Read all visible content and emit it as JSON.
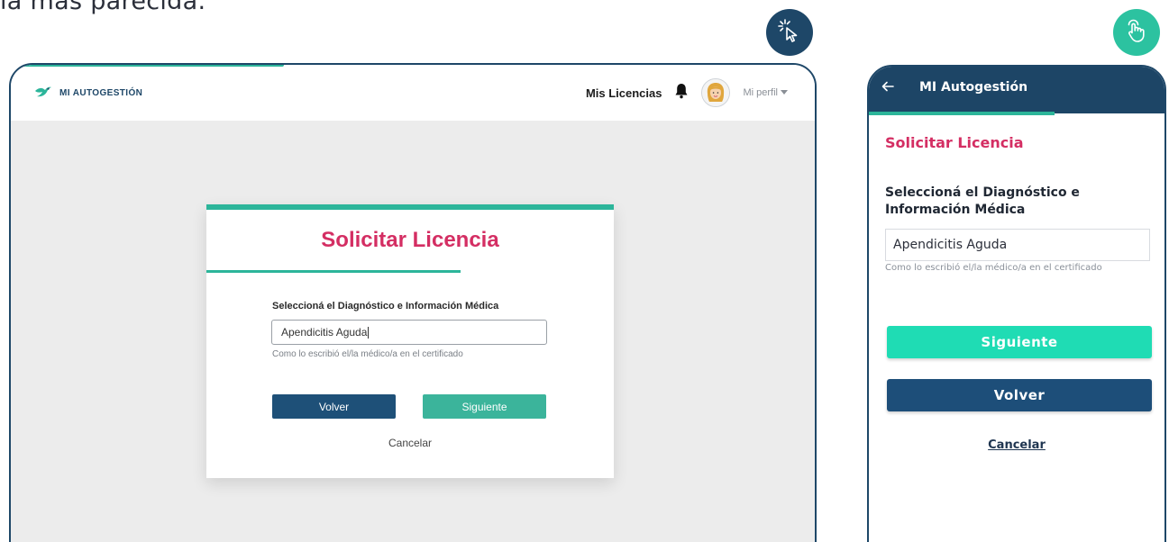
{
  "caption": "la más parecida.",
  "badges": {
    "desktop_icon": "click-cursor-icon",
    "mobile_icon": "tap-hand-icon"
  },
  "desktop": {
    "brand": "MI AUTOGESTIÓN",
    "nav": {
      "licencias": "Mis Licencias",
      "notifications_icon": "bell-icon",
      "profile": "Mi perfil"
    },
    "card": {
      "title": "Solicitar Licencia",
      "label": "Seleccioná el Diagnóstico e Información Médica",
      "input_value": "Apendicitis Aguda",
      "hint": "Como lo escribió el/la médico/a en el certificado",
      "back_button": "Volver",
      "next_button": "Siguiente",
      "cancel_link": "Cancelar"
    }
  },
  "mobile": {
    "app_title": "MI Autogestión",
    "title": "Solicitar Licencia",
    "label": "Seleccioná el Diagnóstico e Información Médica",
    "input_value": "Apendicitis Aguda",
    "hint": "Como lo escribió el/la médico/a en el certificado",
    "next_button": "Siguiente",
    "back_button": "Volver",
    "cancel_link": "Cancelar"
  },
  "colors": {
    "navy": "#1e4768",
    "teal": "#2cb59a",
    "magenta": "#d42e63",
    "mint_button": "#1fdcb4"
  }
}
